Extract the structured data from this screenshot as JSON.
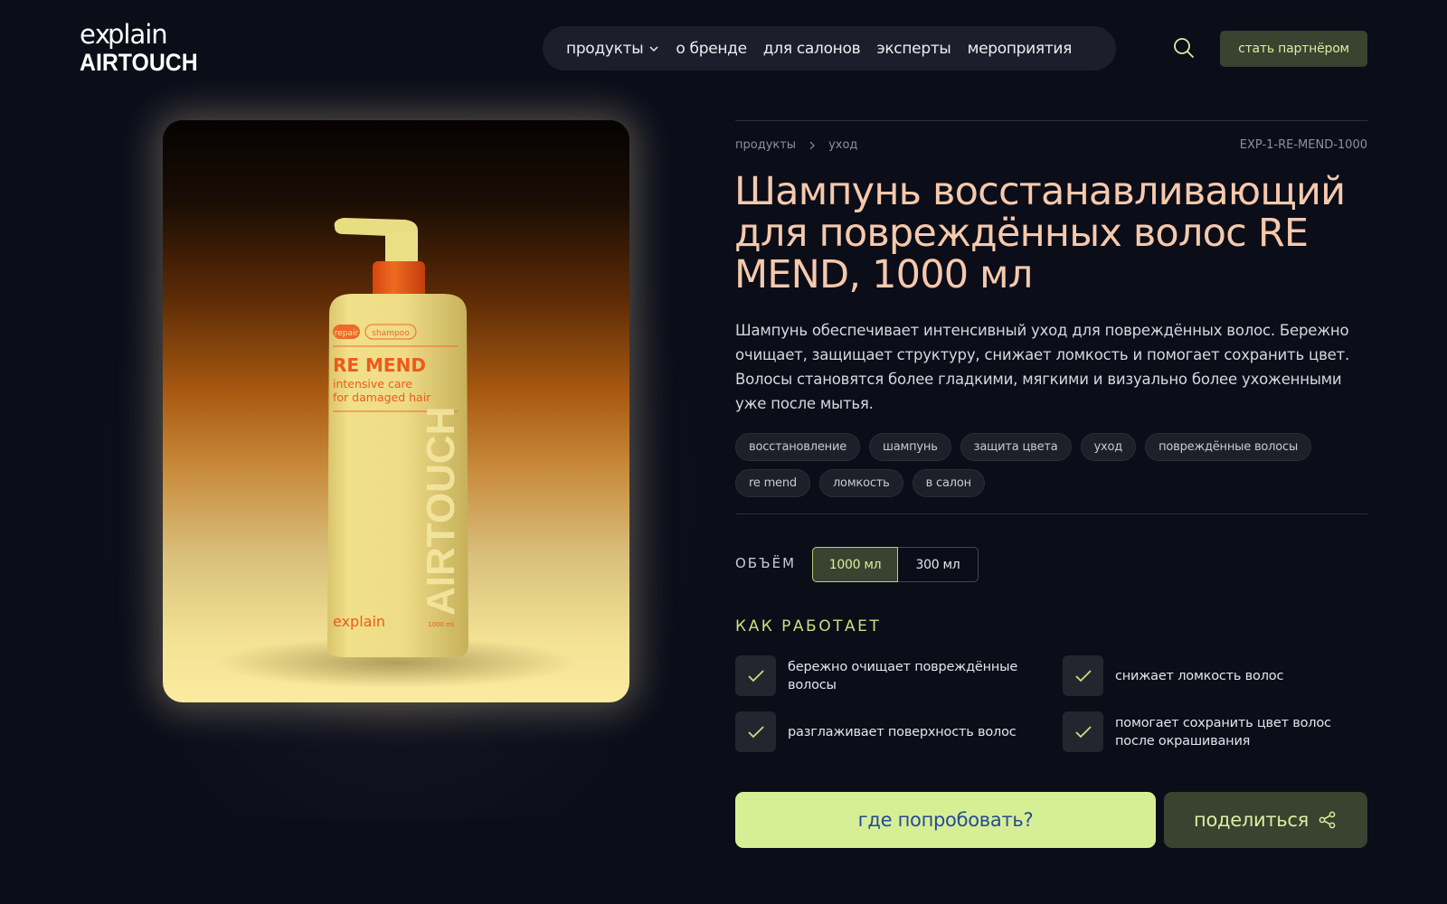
{
  "header": {
    "logo_top": "ex‹plaìn",
    "logo_bottom": "AIRTOUCH",
    "nav": [
      {
        "label": "продукты",
        "has_dropdown": true
      },
      {
        "label": "о бренде"
      },
      {
        "label": "для салонов"
      },
      {
        "label": "эксперты"
      },
      {
        "label": "мероприятия"
      }
    ],
    "partner_label": "стать партнёром",
    "search_icon": "search-icon"
  },
  "product": {
    "image": {
      "bottle_label_tag1": "repair",
      "bottle_label_tag2": "shampoo",
      "bottle_brand": "RE MEND",
      "bottle_line1": "intensive care",
      "bottle_line2": "for damaged hair",
      "bottle_vertical": "AIRTOUCH",
      "bottle_logo": "explain",
      "bottle_volume": "1000 ml"
    },
    "breadcrumb": [
      "продукты",
      "уход"
    ],
    "sku": "EXP-1-RE-MEND-1000",
    "title": "Шампунь восстанавливающий для повреждённых волос RE MEND, 1000 мл",
    "description": "Шампунь обеспечивает интенсивный уход для повреждённых волос. Бережно очищает, защищает структуру, снижает ломкость и помогает сохранить цвет. Волосы становятся более гладкими, мягкими и визуально более ухоженными уже после мытья.",
    "tags": [
      "восстановление",
      "шампунь",
      "защита цвета",
      "уход",
      "повреждённые волосы",
      "re mend",
      "ломкость",
      "в салон"
    ],
    "volume": {
      "label": "ОБЪЁМ",
      "options": [
        "1000 мл",
        "300 мл"
      ],
      "selected": "1000 мл"
    },
    "how_it_works": {
      "title": "КАК РАБОТАЕТ",
      "items": [
        "бережно очищает повреждённые волосы",
        "снижает ломкость волос",
        "разглаживает поверхность волос",
        "помогает сохранить цвет волос после окрашивания"
      ]
    },
    "cta_label": "где попробовать?",
    "share_label": "поделиться"
  },
  "colors": {
    "background": "#0b0d19",
    "title": "#f6c9ac",
    "accent_green": "#d7ef94",
    "accent_dark_green": "#3a4230",
    "cta_text": "#274a97"
  }
}
